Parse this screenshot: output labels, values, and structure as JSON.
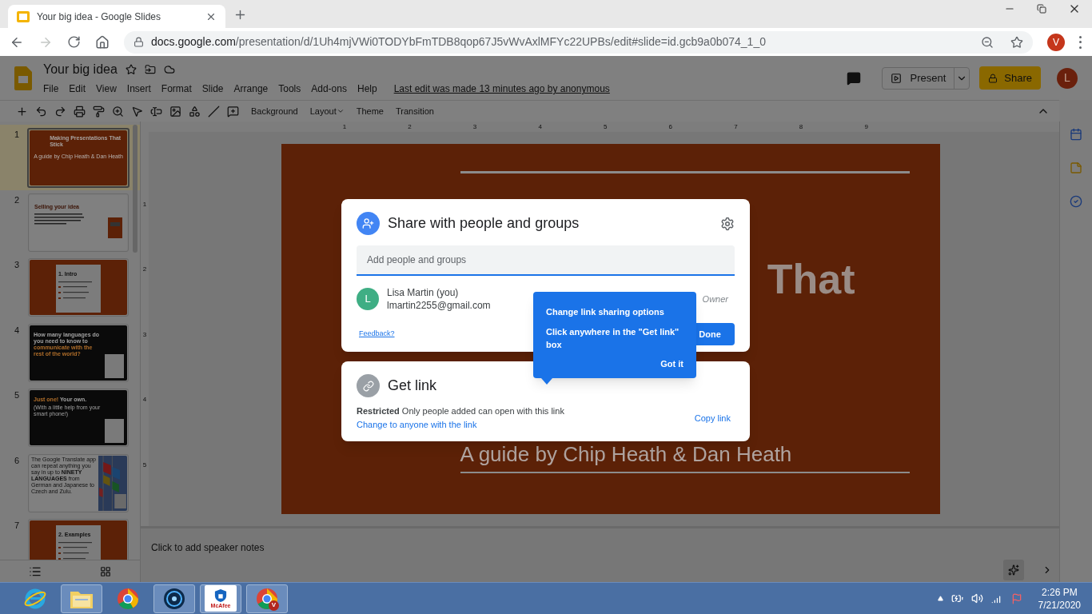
{
  "browser": {
    "tab_title": "Your big idea - Google Slides",
    "url_host": "docs.google.com",
    "url_path": "/presentation/d/1Uh4mjVWi0TODYbFmTDB8qop67J5vWvAxlMFYc22UPBs/edit#slide=id.gcb9a0b074_1_0",
    "profile_initial": "V"
  },
  "doc": {
    "title": "Your big idea",
    "menu": [
      "File",
      "Edit",
      "View",
      "Insert",
      "Format",
      "Slide",
      "Arrange",
      "Tools",
      "Add-ons",
      "Help"
    ],
    "last_edit": "Last edit was made 13 minutes ago by anonymous",
    "present": "Present",
    "share": "Share",
    "avatar_initial": "L"
  },
  "toolbar": {
    "buttons": [
      {
        "label": "Background",
        "caret": false
      },
      {
        "label": "Layout",
        "caret": true
      },
      {
        "label": "Theme",
        "caret": false
      },
      {
        "label": "Transition",
        "caret": false
      }
    ]
  },
  "ruler": {
    "h_ticks": [
      "1",
      "2",
      "3",
      "4",
      "5",
      "6",
      "7",
      "8",
      "9"
    ],
    "v_ticks": [
      "1",
      "2",
      "3",
      "4",
      "5"
    ]
  },
  "slides": [
    {
      "number": "1",
      "kind": "title",
      "selected": true,
      "title": "Making Presentations That Stick",
      "subtitle": "A guide by Chip Heath & Dan Heath"
    },
    {
      "number": "2",
      "kind": "text",
      "selected": false,
      "title": "Selling your idea"
    },
    {
      "number": "3",
      "kind": "card",
      "selected": false,
      "title": "1. Intro"
    },
    {
      "number": "4",
      "kind": "dark",
      "selected": false,
      "parts": [
        {
          "text": "How many languages do you need to know to",
          "accent": false
        },
        {
          "text": "communicate with the rest of the world?",
          "accent": true
        }
      ]
    },
    {
      "number": "5",
      "kind": "dark",
      "selected": false,
      "parts": [
        {
          "text": "Just one!",
          "accent": true
        },
        {
          "text": "Your own.",
          "accent": false
        }
      ],
      "subtitle": "(With a little help from your smart phone!)"
    },
    {
      "number": "6",
      "selected": false,
      "text": "The Google Translate app can repeat anything you say in up to **NINETY LANGUAGES** from German and Japanese to Czech and Zulu."
    },
    {
      "number": "7",
      "kind": "card",
      "selected": false,
      "title": "2. Examples"
    }
  ],
  "canvas": {
    "title_fragment": "That",
    "subtitle": "A guide by Chip Heath & Dan Heath"
  },
  "share_dialog": {
    "title": "Share with people and groups",
    "field_placeholder": "Add people and groups",
    "person": {
      "initial": "L",
      "name": "Lisa Martin (you)",
      "email": "lmartin2255@gmail.com",
      "role": "Owner"
    },
    "feedback": "Feedback?",
    "done": "Done"
  },
  "get_link": {
    "title": "Get link",
    "restriction": "Restricted",
    "description": "Only people added can open with this link",
    "change_link": "Change to anyone with the link",
    "copy_link": "Copy link"
  },
  "tooltip": {
    "title": "Change link sharing options",
    "body": "Click anywhere in the \"Get link\" box",
    "button": "Got it"
  },
  "notes": {
    "placeholder": "Click to add speaker notes"
  },
  "taskbar": {
    "apps": [
      {
        "kind": "ie",
        "open": false
      },
      {
        "kind": "explorer",
        "open": true
      },
      {
        "kind": "chrome",
        "open": false
      },
      {
        "kind": "app",
        "open": true
      },
      {
        "kind": "mcafee",
        "open": true,
        "label": "McAfee"
      },
      {
        "kind": "chrome",
        "open": true,
        "badge": "V"
      }
    ],
    "time": "2:26 PM",
    "date": "7/21/2020"
  }
}
